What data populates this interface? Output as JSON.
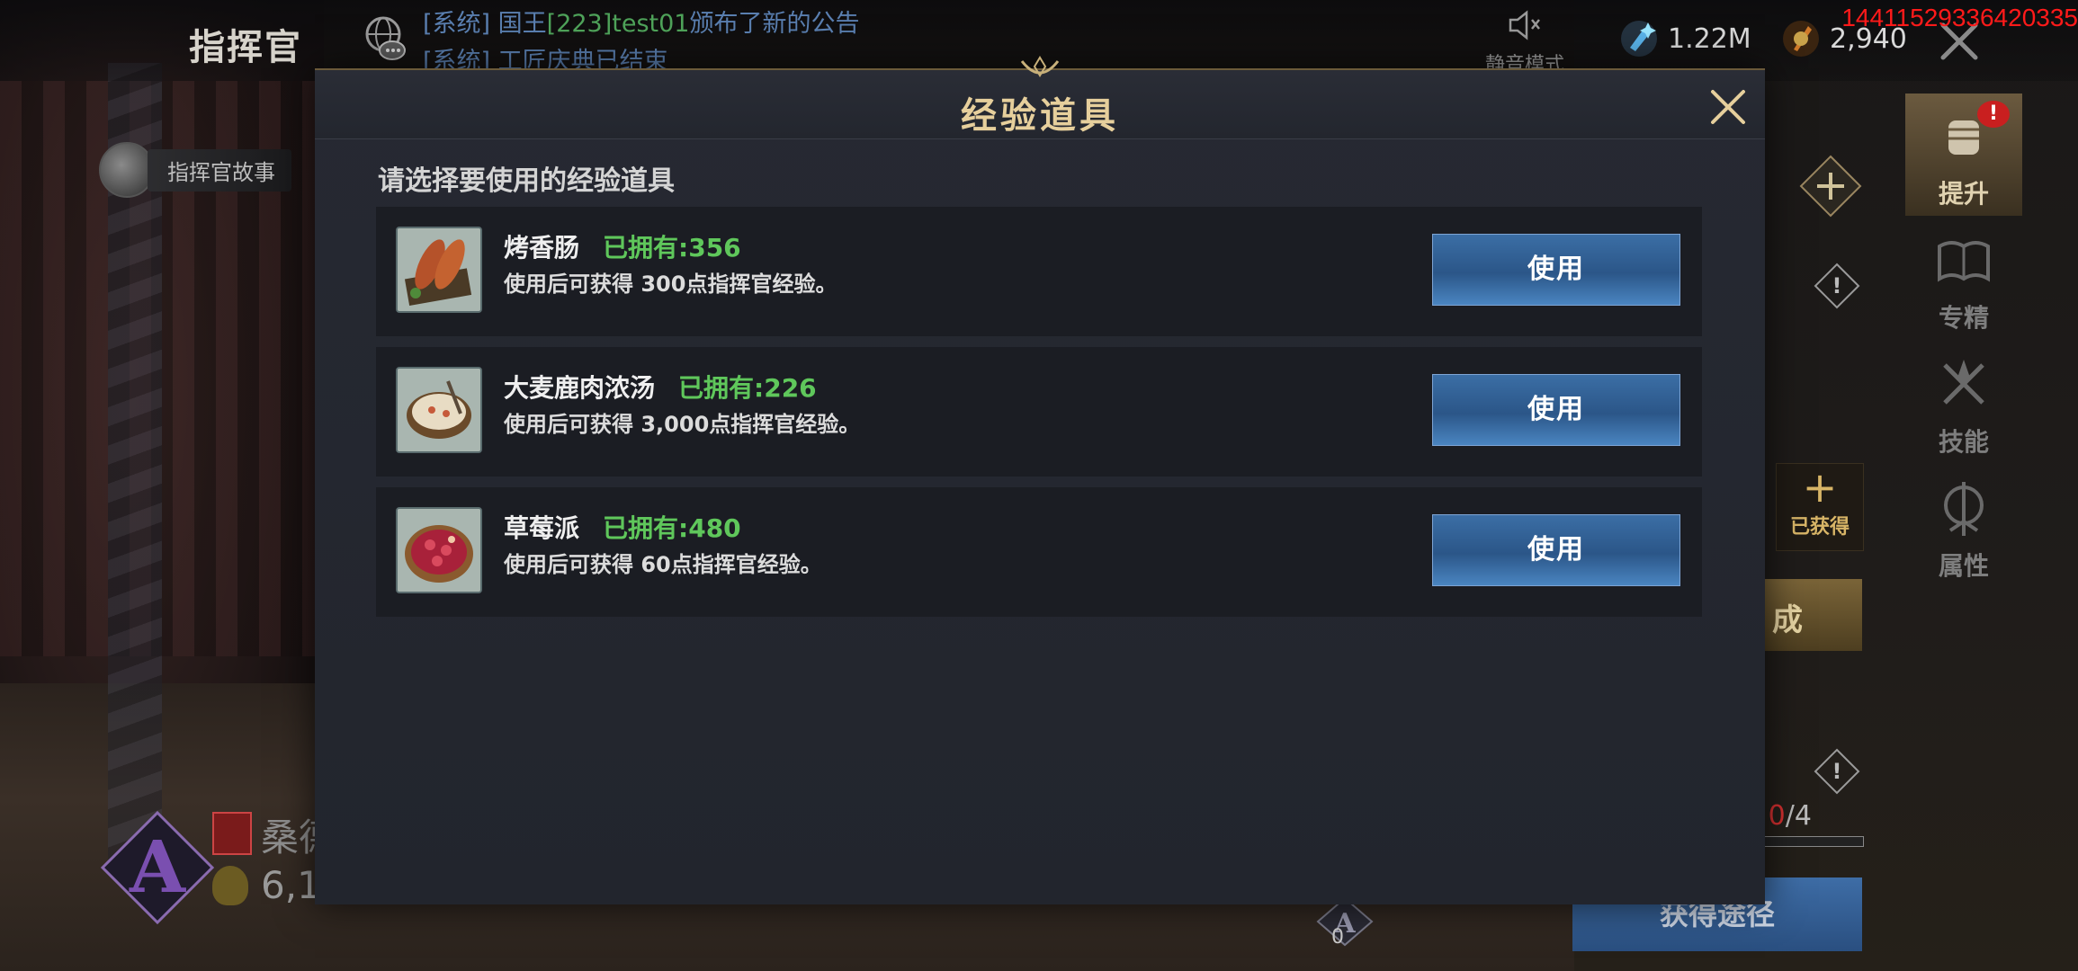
{
  "topbar": {
    "title": "指挥官",
    "chat": {
      "line1": {
        "prefix": "[系统] 国王",
        "highlight": "[223]test01",
        "suffix": "颁布了新的公告"
      },
      "line2": "[系统] 工匠庆典已结束"
    },
    "mute_label": "静音模式",
    "resources": {
      "gems": "1.22M",
      "gold": "2,940"
    },
    "overlay_id": "14411529336420335"
  },
  "left": {
    "story_label": "指挥官故事",
    "rank_name": "桑德",
    "power": "6,1"
  },
  "side_panel": {
    "tabs": [
      {
        "label": "提升",
        "icon": "fist-icon",
        "badge": "!"
      },
      {
        "label": "专精",
        "icon": "book-icon"
      },
      {
        "label": "技能",
        "icon": "sword-icon"
      },
      {
        "label": "属性",
        "icon": "attribute-icon"
      }
    ],
    "obtained_label": "已获得",
    "obtained_plus": "+",
    "gold_bar_text": "成",
    "fragment": {
      "prefix": ": ",
      "current": "0",
      "total": "/4"
    },
    "get_way_label": "获得途径",
    "bottom_count": "0"
  },
  "modal": {
    "title": "经验道具",
    "subtitle": "请选择要使用的经验道具",
    "items": [
      {
        "name": "烤香肠",
        "owned": "已拥有:356",
        "desc": "使用后可获得 300点指挥官经验。",
        "button": "使用",
        "icon": "sausage-icon"
      },
      {
        "name": "大麦鹿肉浓汤",
        "owned": "已拥有:226",
        "desc": "使用后可获得 3,000点指挥官经验。",
        "button": "使用",
        "icon": "soup-icon"
      },
      {
        "name": "草莓派",
        "owned": "已拥有:480",
        "desc": "使用后可获得 60点指挥官经验。",
        "button": "使用",
        "icon": "pie-icon"
      }
    ]
  },
  "colors": {
    "owned_green": "#5fc75b",
    "title_gold": "#e6cf9c",
    "button_blue": "#2b5688"
  }
}
